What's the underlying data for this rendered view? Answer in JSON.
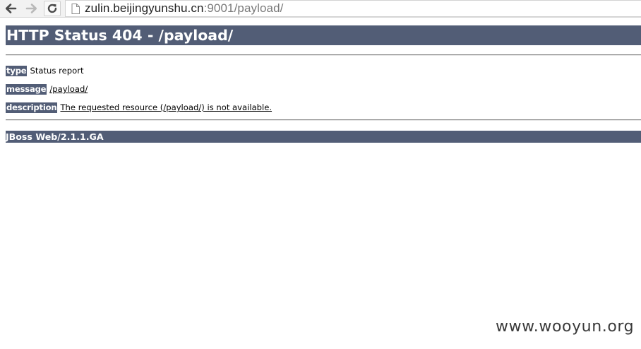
{
  "browser": {
    "url_host": "zulin.beijingyunshu.cn",
    "url_port_path": ":9001/payload/"
  },
  "page": {
    "title": "HTTP Status 404 - /payload/",
    "rows": [
      {
        "label": "type",
        "value": "Status report"
      },
      {
        "label": "message",
        "value": "/payload/"
      },
      {
        "label": "description",
        "value": "The requested resource (/payload/) is not available."
      }
    ],
    "server": "JBoss Web/2.1.1.GA"
  },
  "watermark": "www.wooyun.org",
  "colors": {
    "header_bg": "#525d76",
    "header_text": "#ffffff"
  },
  "icons": [
    "back-arrow-icon",
    "forward-arrow-icon",
    "reload-icon",
    "page-icon"
  ]
}
